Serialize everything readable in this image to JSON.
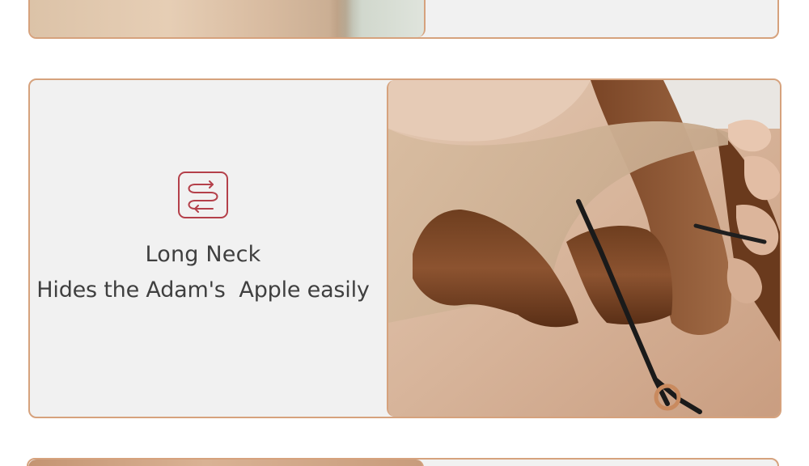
{
  "feature": {
    "title": "Long Neck",
    "subtitle": "Hides the Adam's  Apple easily",
    "icon": "stretch-arrows-icon"
  },
  "colors": {
    "card_border": "#d6a27d",
    "card_background": "#f1f1f1",
    "icon_color": "#b4404a",
    "text_color": "#3f3f3f"
  }
}
